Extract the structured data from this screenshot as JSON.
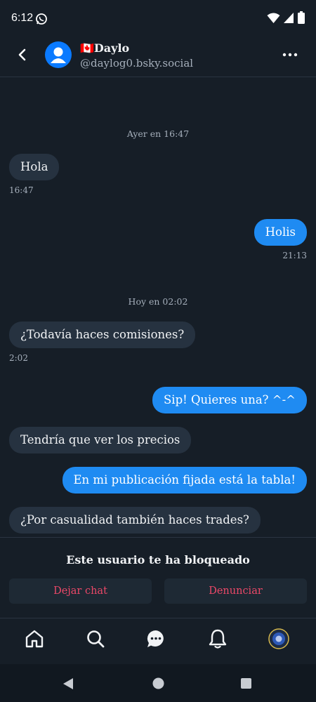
{
  "status_bar": {
    "time": "6:12"
  },
  "header": {
    "flag": "🇨🇦",
    "display_name": "Daylo",
    "handle": "@daylog0.bsky.social"
  },
  "messages": [
    {
      "date_separator": "Ayer en 16:47"
    },
    {
      "text": "Hola",
      "stamp": "16:47"
    },
    {
      "text": "Holis",
      "stamp": "21:13"
    },
    {
      "date_separator": "Hoy en 02:02"
    },
    {
      "text": "¿Todavía haces comisiones?",
      "stamp": "2:02"
    },
    {
      "text": "Sip! Quieres una? ^-^"
    },
    {
      "text": "Tendría que ver los precios"
    },
    {
      "text": "En mi publicación fijada está la tabla!"
    },
    {
      "text": "¿Por casualidad también haces trades?"
    }
  ],
  "blocked": {
    "title": "Este usuario te ha bloqueado",
    "leave_label": "Dejar chat",
    "report_label": "Denunciar"
  },
  "colors": {
    "accent": "#1f8bf2",
    "danger": "#ec4868",
    "background": "#161e27"
  }
}
